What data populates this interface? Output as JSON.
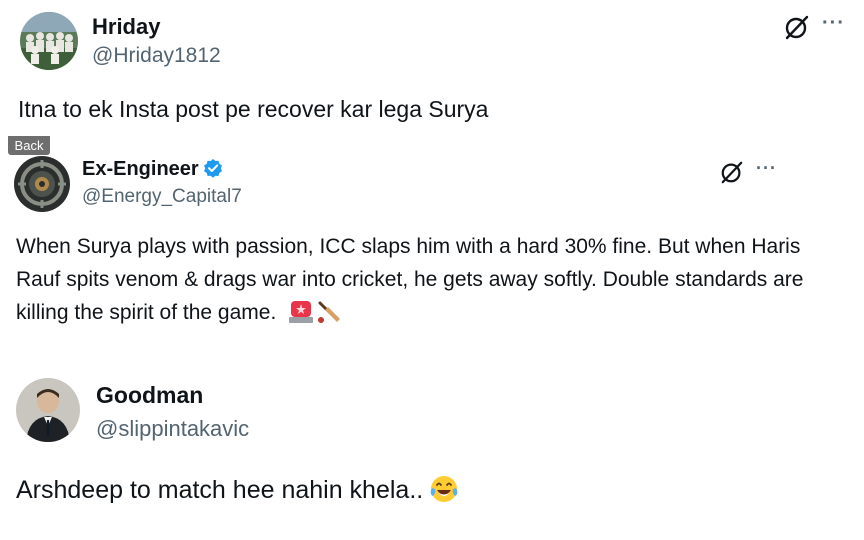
{
  "posts": [
    {
      "name": "Hriday",
      "handle": "@Hriday1812",
      "text": "Itna to ek Insta post pe recover kar lega Surya",
      "more_label": "···"
    },
    {
      "name": "Ex-Engineer",
      "handle": "@Energy_Capital7",
      "text": "When Surya plays with passion, ICC slaps him with a hard 30% fine. But when Haris Rauf spits venom & drags war into cricket, he gets away softly. Double standards are killing the spirit of the game.",
      "more_label": "···",
      "emojis": [
        "police-light-emoji",
        "cricket-bat-emoji"
      ]
    },
    {
      "name": "Goodman",
      "handle": "@slippintakavic",
      "text": "Arshdeep to match hee nahin khela..",
      "emojis": [
        "laughing-tears-emoji"
      ]
    }
  ],
  "back_label": "Back",
  "colors": {
    "text": "#0f1419",
    "secondary": "#536471",
    "verified": "#1d9bf0",
    "back_button": "#6e6e6e"
  }
}
